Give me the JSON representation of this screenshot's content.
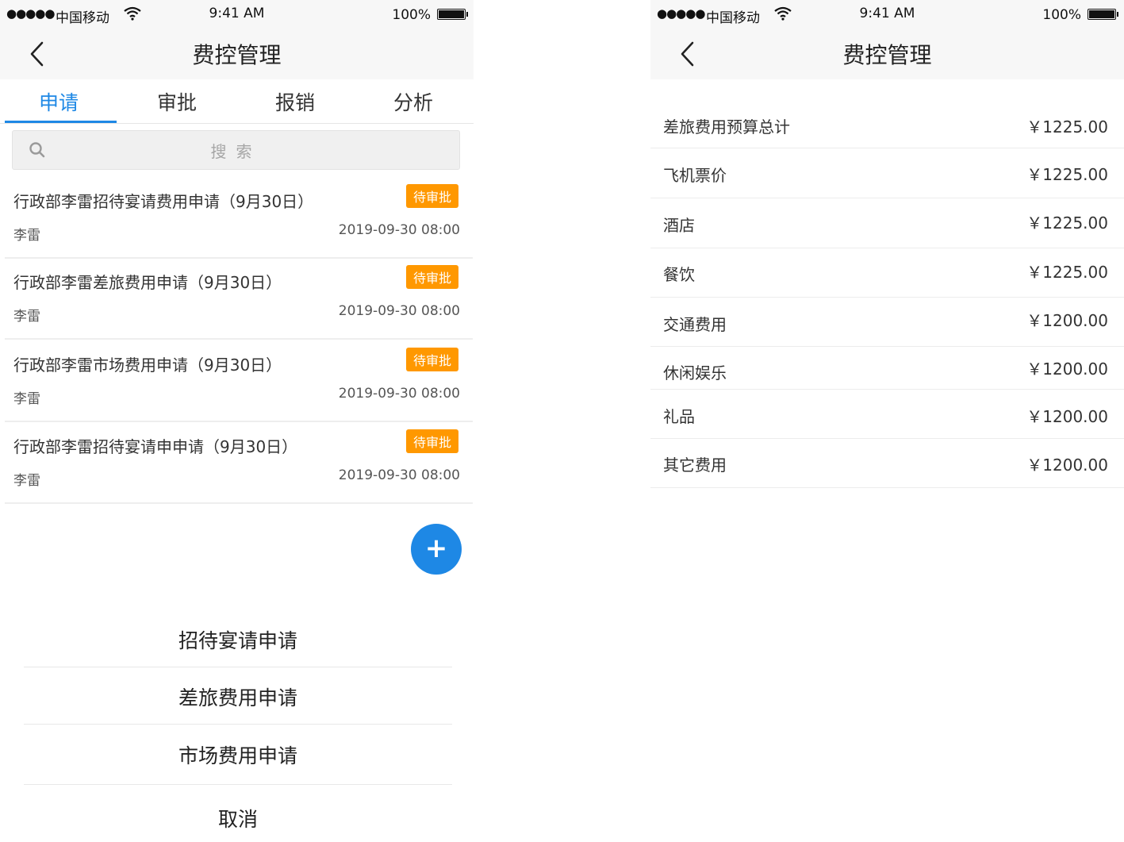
{
  "status_bar": {
    "carrier": "中国移动",
    "time": "9:41 AM",
    "battery": "100%"
  },
  "left_screen": {
    "title": "费控管理",
    "tabs": [
      {
        "label": "申请",
        "active": true
      },
      {
        "label": "审批",
        "active": false
      },
      {
        "label": "报销",
        "active": false
      },
      {
        "label": "分析",
        "active": false
      }
    ],
    "search": {
      "placeholder": "搜索"
    },
    "items": [
      {
        "title": "行政部李雷招待宴请费用申请（9月30日）",
        "status": "待审批",
        "user": "李雷",
        "time": "2019-09-30 08:00"
      },
      {
        "title": "行政部李雷差旅费用申请（9月30日）",
        "status": "待审批",
        "user": "李雷",
        "time": "2019-09-30 08:00"
      },
      {
        "title": "行政部李雷市场费用申请（9月30日）",
        "status": "待审批",
        "user": "李雷",
        "time": "2019-09-30 08:00"
      },
      {
        "title": "行政部李雷招待宴请申申请（9月30日）",
        "status": "待审批",
        "user": "李雷",
        "time": "2019-09-30 08:00"
      }
    ],
    "fab_icon": "plus-icon",
    "action_sheet": {
      "options": [
        "招待宴请申请",
        "差旅费用申请",
        "市场费用申请"
      ],
      "cancel": "取消"
    }
  },
  "right_screen": {
    "title": "费控管理",
    "budget_rows": [
      {
        "label": "差旅费用预算总计",
        "value": "￥1225.00"
      },
      {
        "label": "飞机票价",
        "value": "￥1225.00"
      },
      {
        "label": "酒店",
        "value": "￥1225.00"
      },
      {
        "label": "餐饮",
        "value": "￥1225.00"
      },
      {
        "label": "交通费用",
        "value": "￥1200.00"
      },
      {
        "label": "休闲娱乐",
        "value": "￥1200.00"
      },
      {
        "label": "礼品",
        "value": "￥1200.00"
      },
      {
        "label": "其它费用",
        "value": "￥1200.00"
      }
    ]
  },
  "colors": {
    "accent": "#1e88e5",
    "badge": "#ff9800",
    "bar_bg": "#f7f7f7"
  }
}
